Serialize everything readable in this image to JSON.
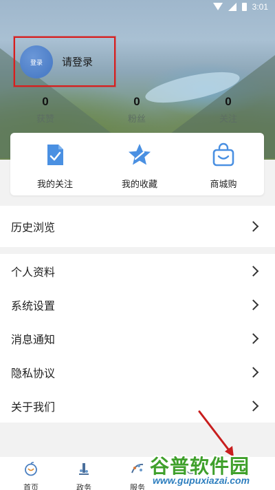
{
  "status_bar": {
    "time": "3:01"
  },
  "profile": {
    "avatar_text": "登录",
    "login_prompt": "请登录"
  },
  "stats": [
    {
      "value": "0",
      "label": "获赞"
    },
    {
      "value": "0",
      "label": "粉丝"
    },
    {
      "value": "0",
      "label": "关注"
    }
  ],
  "quick_actions": [
    {
      "label": "我的关注",
      "icon": "document-check-icon"
    },
    {
      "label": "我的收藏",
      "icon": "star-icon"
    },
    {
      "label": "商城购",
      "icon": "shopping-bag-icon"
    }
  ],
  "menu_primary": [
    {
      "label": "历史浏览"
    }
  ],
  "menu_secondary": [
    {
      "label": "个人资料"
    },
    {
      "label": "系统设置"
    },
    {
      "label": "消息通知"
    },
    {
      "label": "隐私协议"
    },
    {
      "label": "关于我们"
    }
  ],
  "tabbar": [
    {
      "label": "首页",
      "icon": "apple-icon"
    },
    {
      "label": "政务",
      "icon": "government-icon"
    },
    {
      "label": "服务",
      "icon": "service-icon"
    },
    {
      "label": "",
      "icon": "tab-icon"
    },
    {
      "label": "",
      "icon": "profile-icon"
    }
  ],
  "watermark": {
    "title": "谷普软件园",
    "url": "www.gupuxiazai.com"
  },
  "colors": {
    "accent_blue": "#4a90e2",
    "highlight_red": "#d81e1e",
    "watermark_green": "#3fa02b",
    "watermark_blue": "#2e7fbf"
  }
}
